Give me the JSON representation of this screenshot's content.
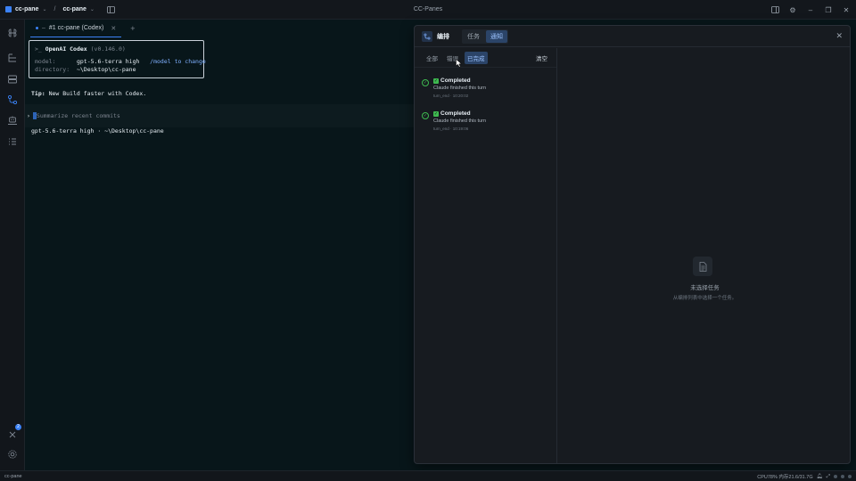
{
  "titlebar": {
    "workspace": "cc-pane",
    "project": "cc-pane",
    "separator": "/",
    "app_title": "CC-Panes"
  },
  "terminal": {
    "tab_label": "#1 cc-pane (Codex)",
    "tab_prefix": "• –",
    "codex_name": "OpenAI Codex",
    "codex_version": "(v0.146.0)",
    "model_label": "model:",
    "model_value": "gpt-5.6-terra high",
    "model_hint": "/model to change",
    "directory_label": "directory:",
    "directory_value": "~\\Desktop\\cc-pane",
    "tip_label": "Tip:",
    "tip_text": "New Build faster with Codex.",
    "prompt_placeholder": "Summarize recent commits",
    "status_line": "gpt-5.6-terra high · ~\\Desktop\\cc-pane"
  },
  "panel": {
    "title": "编排",
    "tabs": [
      {
        "label": "任务",
        "active": false
      },
      {
        "label": "通知",
        "active": true
      }
    ],
    "filters": [
      {
        "label": "全部",
        "active": false
      },
      {
        "label": "错误",
        "active": false
      },
      {
        "label": "已完成",
        "active": true
      }
    ],
    "clear_label": "清空",
    "notifications": [
      {
        "title": "Completed",
        "body": "Claude finished this turn",
        "meta": "turn_end · 10:20:02"
      },
      {
        "title": "Completed",
        "body": "Claude finished this turn",
        "meta": "turn_end · 10:19:06"
      }
    ],
    "empty_title": "未选择任务",
    "empty_subtitle": "从编排列表中选择一个任务。"
  },
  "activity": {
    "badge_count": "2"
  },
  "statusbar": {
    "left": "cc-pane",
    "resources": "CPU78% 内存21.6/31.7G"
  },
  "colors": {
    "accent": "#3b82f6",
    "success": "#3fb950",
    "terminal_bg": "#08161a"
  }
}
